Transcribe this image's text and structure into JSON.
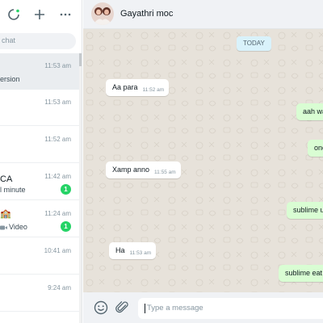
{
  "sidebar": {
    "search_placeholder": "chat",
    "chats": [
      {
        "name": "",
        "preview": "ersion",
        "time": "11:53 am",
        "badge": "",
        "active": true
      },
      {
        "name": "",
        "preview": "",
        "time": "11:53 am",
        "badge": ""
      },
      {
        "name": "",
        "preview": "",
        "time": "11:52 am",
        "badge": ""
      },
      {
        "name": "CA",
        "preview": "l minute",
        "time": "11:42 am",
        "badge": "1"
      },
      {
        "name": "🏫",
        "preview": "Video",
        "time": "11:24 am",
        "badge": "1"
      },
      {
        "name": "",
        "preview": "",
        "time": "10:41 am",
        "badge": ""
      },
      {
        "name": "",
        "preview": "",
        "time": "9:24 am",
        "badge": ""
      }
    ]
  },
  "conversation": {
    "contact_name": "Gayathri moc",
    "date_chip": "TODAY",
    "messages": [
      {
        "dir": "in",
        "text": "Aa para",
        "time": "11:52 am"
      },
      {
        "dir": "out",
        "text": "aah wa",
        "time": ""
      },
      {
        "dir": "out",
        "text": "one",
        "time": ""
      },
      {
        "dir": "in",
        "text": "Xamp anno",
        "time": "11:55 am"
      },
      {
        "dir": "out",
        "text": "sublime u",
        "time": ""
      },
      {
        "dir": "in",
        "text": "Ha",
        "time": "11:53 am"
      },
      {
        "dir": "out",
        "text": "sublime eat",
        "time": ""
      }
    ],
    "composer_placeholder": "Type a message"
  },
  "colors": {
    "accent_green": "#25d366",
    "outgoing_bubble": "#d9fdd3",
    "chat_background": "#e7e2da",
    "date_chip_bg": "#d9f2fb"
  },
  "icons": [
    "status-icon",
    "new-chat-icon",
    "menu-icon",
    "search-icon",
    "emoji-icon",
    "attach-icon",
    "video-icon"
  ]
}
